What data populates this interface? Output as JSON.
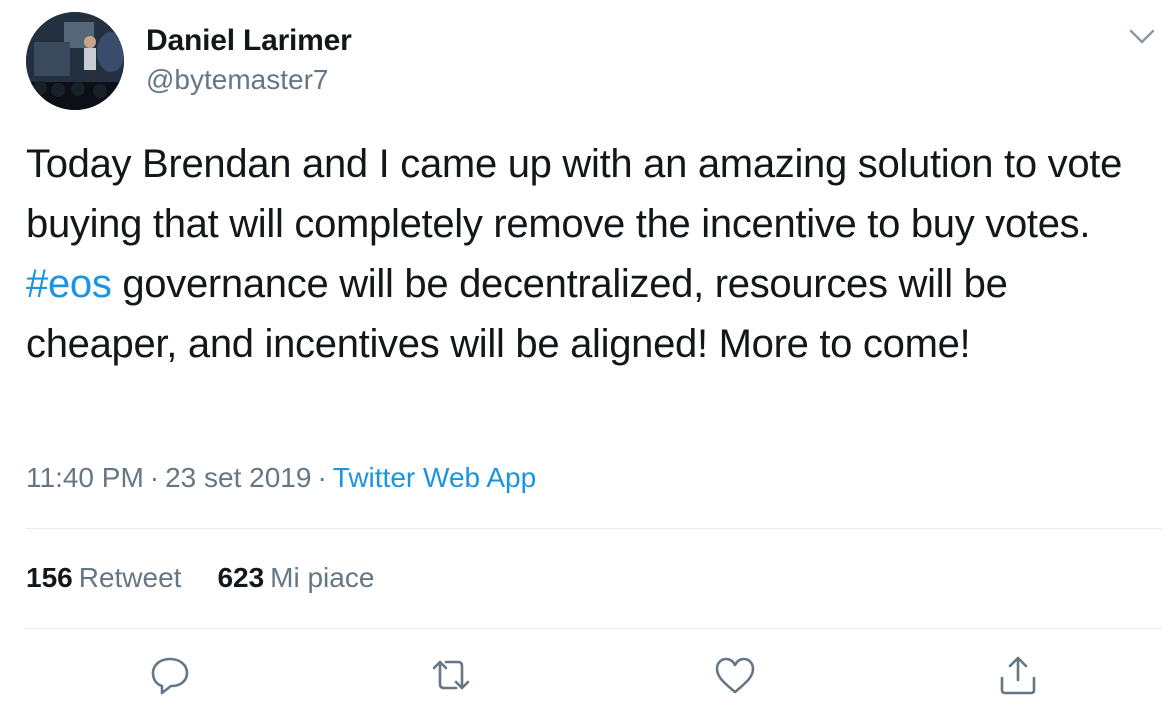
{
  "user": {
    "display_name": "Daniel Larimer",
    "handle": "@bytemaster7",
    "avatar_icon": "avatar-photo"
  },
  "tweet": {
    "text_before": "Today Brendan and I came up with an amazing solution to vote buying that will completely remove the incentive to buy votes.  ",
    "hashtag": "#eos",
    "text_after": " governance will be decentralized, resources will be cheaper, and incentives will be aligned! More to come!"
  },
  "meta": {
    "time": "11:40 PM",
    "separator": "·",
    "date": "23 set 2019",
    "source": "Twitter Web App"
  },
  "stats": {
    "retweets_count": "156",
    "retweets_label": "Retweet",
    "likes_count": "623",
    "likes_label": "Mi piace"
  },
  "actions": {
    "reply_icon": "reply-icon",
    "retweet_icon": "retweet-icon",
    "like_icon": "like-icon",
    "share_icon": "share-icon",
    "menu_icon": "chevron-down-icon"
  },
  "colors": {
    "text": "#14171a",
    "secondary": "#657786",
    "link": "#1b95e0",
    "divider": "#e6ecf0"
  }
}
